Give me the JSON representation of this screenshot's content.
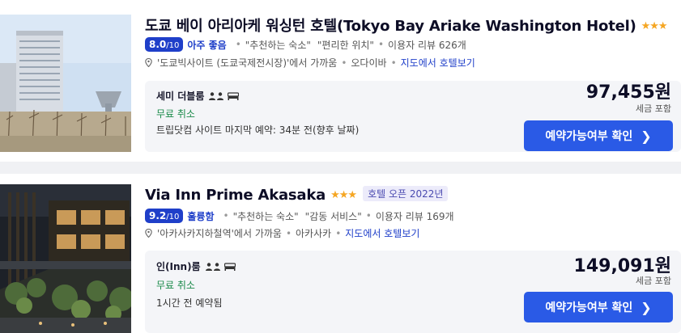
{
  "hotels": [
    {
      "title": "도쿄 베이 아리아케 워싱턴 호텔(Tokyo Bay Ariake Washington Hotel)",
      "stars": "★★★",
      "tag": "",
      "score": "8.0",
      "score_max": "/10",
      "rating_word": "아주 좋음",
      "quote1": "\"추천하는 숙소\"",
      "quote2": "\"편리한 위치\"",
      "reviews": "이용자 리뷰 626개",
      "location": "'도쿄빅사이트 (도쿄국제전시장)'에서 가까움",
      "area": "오다이바",
      "map_link": "지도에서 호텔보기",
      "room_name": "세미 더블룸",
      "cancel": "무료 취소",
      "note": "트립닷컴 사이트 마지막 예약: 34분 전(향후 날짜)",
      "price": "97,455원",
      "tax": "세금 포함",
      "cta": "예약가능여부 확인"
    },
    {
      "title": "Via Inn Prime Akasaka",
      "stars": "★★★",
      "tag": "호텔 오픈 2022년",
      "score": "9.2",
      "score_max": "/10",
      "rating_word": "훌륭함",
      "quote1": "\"추천하는 숙소\"",
      "quote2": "\"감동 서비스\"",
      "reviews": "이용자 리뷰 169개",
      "location": "'아카사카지하철역'에서 가까움",
      "area": "아카사카",
      "map_link": "지도에서 호텔보기",
      "room_name": "인(Inn)룸",
      "cancel": "무료 취소",
      "note": "1시간 전 예약됨",
      "price": "149,091원",
      "tax": "세금 포함",
      "cta": "예약가능여부 확인"
    }
  ],
  "colors": {
    "primary": "#2a5ae6",
    "score_bg": "#1f3fc9",
    "free_cancel": "#1a8a4a",
    "stars": "#f5a623"
  },
  "icons": {
    "location": "map-pin-icon",
    "guests": "person-icon",
    "bed": "bed-icon",
    "chevron": "chevron-right-icon"
  }
}
